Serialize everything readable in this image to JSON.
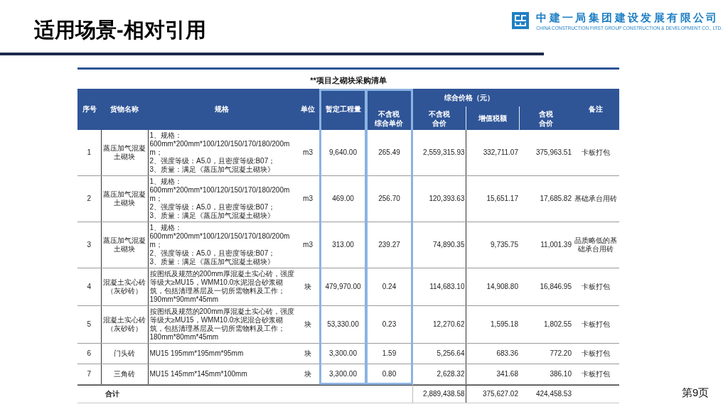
{
  "slide": {
    "title": "适用场景-相对引用",
    "page_number": "第9页"
  },
  "company": {
    "name": "中建一局集团建设发展有限公司",
    "english_name": "CHINA CONSTRUCTION FIRST GROUP CONSTRUCTION & DEVELOPMENT CO., LTD."
  },
  "table": {
    "title": "**项目之砌块采购清单",
    "columns": [
      {
        "label": "序号",
        "highlighted": false
      },
      {
        "label": "货物名称",
        "highlighted": false
      },
      {
        "label": "规格",
        "highlighted": false
      },
      {
        "label": "单位",
        "highlighted": false
      },
      {
        "label": "暂定工程量",
        "highlighted": true
      },
      {
        "label": "综合价格（元）",
        "colspan": 4,
        "children": [
          {
            "lines": [
              "不含税",
              "综合单价"
            ],
            "highlighted": true
          },
          {
            "lines": [
              "不含税",
              "合价"
            ],
            "highlighted": false
          },
          {
            "label": "增值税额",
            "highlighted": false
          },
          {
            "lines": [
              "含税",
              "合价"
            ],
            "highlighted": false
          }
        ]
      },
      {
        "label": "备注",
        "highlighted": false
      }
    ],
    "rows": [
      {
        "cells": [
          "1",
          "蒸压加气混凝土砌块",
          "1、规格：\n600mm*200mm*100/120/150/170/180/200mm；\n2、强度等级：A5.0，且密度等级:B07；\n3、质量：满足《蒸压加气混凝土砌块》",
          "m3",
          "9,640.00",
          "265.49",
          "2,559,315.93",
          "332,711.07",
          "375,963.51",
          "卡板打包"
        ]
      },
      {
        "cells": [
          "2",
          "蒸压加气混凝土砌块",
          "1、规格：\n600mm*200mm*100/120/150/170/180/200mm；\n2、强度等级：A5.0，且密度等级:B07；\n3、质量：满足《蒸压加气混凝土砌块》",
          "m3",
          "469.00",
          "256.70",
          "120,393.63",
          "15,651.17",
          "17,685.82",
          "基础承台用砖"
        ]
      },
      {
        "cells": [
          "3",
          "蒸压加气混凝土砌块",
          "1、规格：\n600mm*200mm*100/120/150/170/180/200mm；\n2、强度等级：A5.0，且密度等级:B07；\n3、质量：满足《蒸压加气混凝土砌块》",
          "m3",
          "313.00",
          "239.27",
          "74,890.35",
          "9,735.75",
          "11,001.39",
          "品质略低的基础承台用砖"
        ]
      },
      {
        "cells": [
          "4",
          "混凝土实心砖（灰砂砖）",
          "按图纸及规范的200mm厚混凝土实心砖，强度等级大≥MU15，WMM10.0水泥混合砂浆砌筑，包括清理基层及一切所需物料及工作；\n190mm*90mm*45mm",
          "块",
          "479,970.00",
          "0.24",
          "114,683.10",
          "14,908.80",
          "16,846.95",
          "卡板打包"
        ]
      },
      {
        "cells": [
          "5",
          "混凝土实心砖（灰砂砖）",
          "按图纸及规范的200mm厚混凝土实心砖，强度等级大≥MU15，WMM10.0水泥混合砂浆砌筑，包括清理基层及一切所需物料及工作；\n180mm*80mm*45mm",
          "块",
          "53,330.00",
          "0.23",
          "12,270.62",
          "1,595.18",
          "1,802.55",
          "卡板打包"
        ]
      },
      {
        "cells": [
          "6",
          "门头砖",
          "MU15 195mm*195mm*95mm",
          "块",
          "3,300.00",
          "1.59",
          "5,256.64",
          "683.36",
          "772.20",
          "卡板打包"
        ]
      },
      {
        "cells": [
          "7",
          "三角砖",
          "MU15 145mm*145mm*100mm",
          "块",
          "3,300.00",
          "0.80",
          "2,628.32",
          "341.68",
          "386.10",
          "卡板打包"
        ]
      }
    ],
    "total": {
      "label": "合计",
      "amount_excl_tax": "2,889,438.58",
      "vat": "375,627.02",
      "amount_incl_tax": "424,458.53"
    }
  }
}
